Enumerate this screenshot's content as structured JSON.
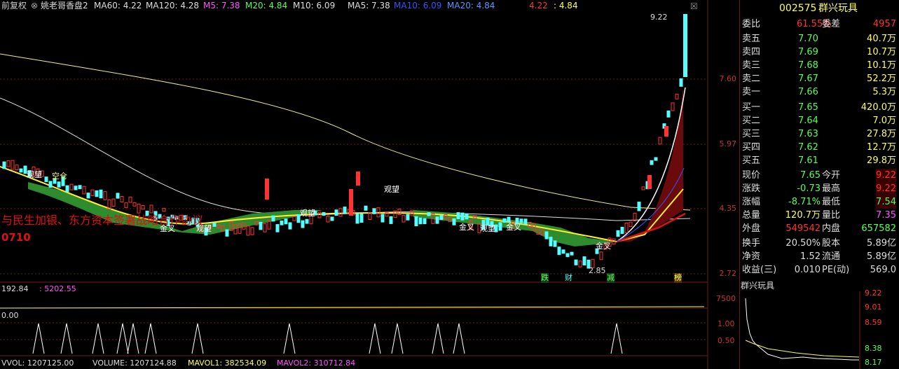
{
  "chart_header": {
    "restore": "前复权",
    "indicator_name": "姚老哥香盘2",
    "ma60": "MA60: 4.22",
    "ma120": "MA120: 4.28",
    "m5": "M5: 7.38",
    "m20": "M20: 4.84",
    "m10": "M10: 6.09",
    "ma5": "MA5: 7.38",
    "ma10": "MA10: 6.09",
    "ma20": "MA20: 4.84",
    "v1": "4.22",
    "v2": ": 4.84"
  },
  "price_axis": [
    "7.60",
    "5.97",
    "4.35",
    "2.72"
  ],
  "price_top": "9.22",
  "price_low": "2.85",
  "signal_labels": {
    "die": "跌",
    "cai": "财",
    "jian": "减",
    "bang": "榜"
  },
  "chart_annotations": [
    "观望",
    "空仓",
    "金叉",
    "观望",
    "观望",
    "观望",
    "金叉",
    "观望",
    "金叉",
    "金叉"
  ],
  "overlay_text": "与民生加银、东方资本签署战略合作协议",
  "overlay_code": "0710",
  "vol_header": {
    "a": "192.84",
    "b": ": 5202.55"
  },
  "vol_axis": "7500",
  "ind3_header": "0.00",
  "ind3_axis": [
    "1.00",
    "0.50"
  ],
  "bottom_header": {
    "vvol": "VVOL: 1207125.00",
    "volume": "VOLUME: 1207124.88",
    "mavol1": "MAVOL1: 382534.09",
    "mavol2": "MAVOL2: 310712.84"
  },
  "stock": {
    "code": "002575",
    "name": "群兴玩具"
  },
  "weibi": {
    "label": "委比",
    "value": "61.55%",
    "diff_label": "委差",
    "diff": "4957"
  },
  "sell": [
    {
      "label": "卖五",
      "price": "7.70",
      "vol": "40.7万"
    },
    {
      "label": "卖四",
      "price": "7.69",
      "vol": "10.7万"
    },
    {
      "label": "卖三",
      "price": "7.68",
      "vol": "10.1万"
    },
    {
      "label": "卖二",
      "price": "7.67",
      "vol": "52.2万"
    },
    {
      "label": "卖一",
      "price": "7.66",
      "vol": "5.3万"
    }
  ],
  "buy": [
    {
      "label": "买一",
      "price": "7.65",
      "vol": "420.0万"
    },
    {
      "label": "买二",
      "price": "7.64",
      "vol": "7.0万"
    },
    {
      "label": "买三",
      "price": "7.63",
      "vol": "27.8万"
    },
    {
      "label": "买四",
      "price": "7.62",
      "vol": "12.7万"
    },
    {
      "label": "买五",
      "price": "7.61",
      "vol": "29.8万"
    }
  ],
  "quote": [
    {
      "l1": "现价",
      "v1": "7.65",
      "l2": "今开",
      "v2": "9.22"
    },
    {
      "l1": "涨跌",
      "v1": "-0.73",
      "l2": "最高",
      "v2": "9.22"
    },
    {
      "l1": "涨幅",
      "v1": "-8.71%",
      "l2": "最低",
      "v2": "7.54"
    },
    {
      "l1": "总量",
      "v1": "120.7万",
      "l2": "量比",
      "v2": "7.35"
    },
    {
      "l1": "外盘",
      "v1": "549542",
      "l2": "内盘",
      "v2": "657582"
    }
  ],
  "fin": [
    {
      "l1": "换手",
      "v1": "20.50%",
      "l2": "股本",
      "v2": "5.89亿"
    },
    {
      "l1": "净资",
      "v1": "1.52",
      "l2": "流通",
      "v2": "5.89亿"
    },
    {
      "l1": "收益(三)",
      "v1": "0.010",
      "l2": "PE(动)",
      "v2": "569.0"
    }
  ],
  "mini": {
    "title": "群兴玩具",
    "axis": [
      "9.22",
      "9.01",
      "8.59",
      "8.38",
      "8.17"
    ]
  },
  "colors": {
    "red": "#ff3333",
    "green": "#33ff33",
    "yellow": "#ffff55",
    "cyan": "#55ffff",
    "magenta": "#ff55ff"
  }
}
